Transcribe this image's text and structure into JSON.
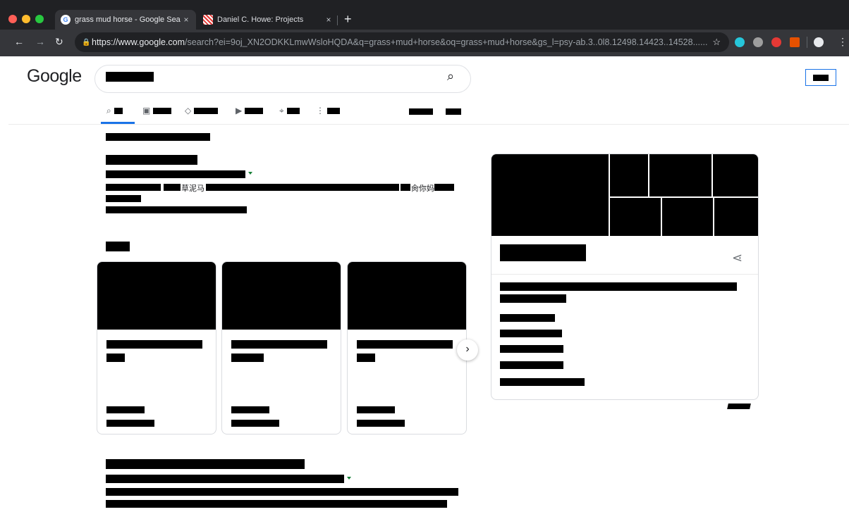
{
  "browser": {
    "tabs": [
      {
        "title": "grass mud horse - Google Sea",
        "active": true,
        "favicon": "google-icon"
      },
      {
        "title": "Daniel C. Howe: Projects",
        "active": false,
        "favicon": "pattern-icon"
      }
    ],
    "new_tab": "+",
    "close_glyph": "×",
    "url_host": "https://www.google.com",
    "url_path": "/search?ei=9oj_XN2ODKKLmwWsloHQDA&q=grass+mud+horse&oq=grass+mud+horse&gs_l=psy-ab.3..0l8.12498.14423..14528......"
  },
  "google": {
    "logo": "Google"
  },
  "results": {
    "snippet_chars_1": "草泥马",
    "snippet_chars_2": "肏你妈"
  },
  "colors": {
    "accent": "#1a73e8",
    "url_green": "#188038",
    "chrome_dark": "#202124"
  }
}
